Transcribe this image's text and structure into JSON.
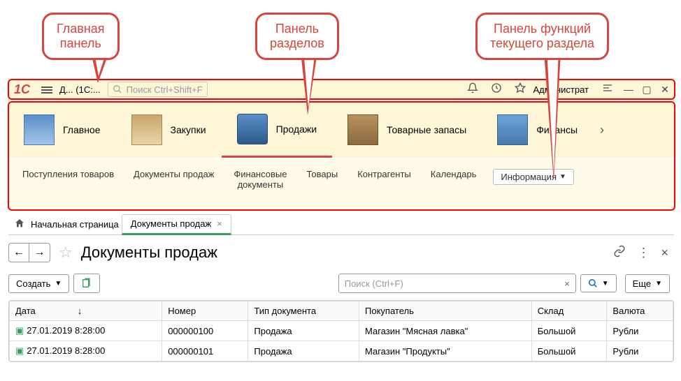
{
  "callouts": {
    "main": "Главная\nпанель",
    "sections": "Панель\nразделов",
    "functions": "Панель функций\nтекущего раздела"
  },
  "topbar": {
    "title": "Д... (1С:...",
    "search_placeholder": "Поиск Ctrl+Shift+F",
    "user": "Администрат"
  },
  "sections": [
    {
      "label": "Главное"
    },
    {
      "label": "Закупки"
    },
    {
      "label": "Продажи"
    },
    {
      "label": "Товарные запасы"
    },
    {
      "label": "Финансы"
    }
  ],
  "funcs": [
    "Поступления товаров",
    "Документы продаж",
    "Финансовые\nдокументы",
    "Товары",
    "Контрагенты",
    "Календарь"
  ],
  "func_button": "Информация",
  "tabs": {
    "home": "Начальная страница",
    "active": "Документы продаж"
  },
  "page": {
    "title": "Документы продаж",
    "create_btn": "Создать",
    "search_placeholder": "Поиск (Ctrl+F)",
    "more_btn": "Еще"
  },
  "table": {
    "headers": [
      "Дата",
      "Номер",
      "Тип документа",
      "Покупатель",
      "Склад",
      "Валюта"
    ],
    "rows": [
      {
        "date": "27.01.2019 8:28:00",
        "num": "000000100",
        "type": "Продажа",
        "buyer": "Магазин \"Мясная лавка\"",
        "wh": "Большой",
        "cur": "Рубли"
      },
      {
        "date": "27.01.2019 8:28:00",
        "num": "000000101",
        "type": "Продажа",
        "buyer": "Магазин \"Продукты\"",
        "wh": "Большой",
        "cur": "Рубли"
      }
    ]
  }
}
